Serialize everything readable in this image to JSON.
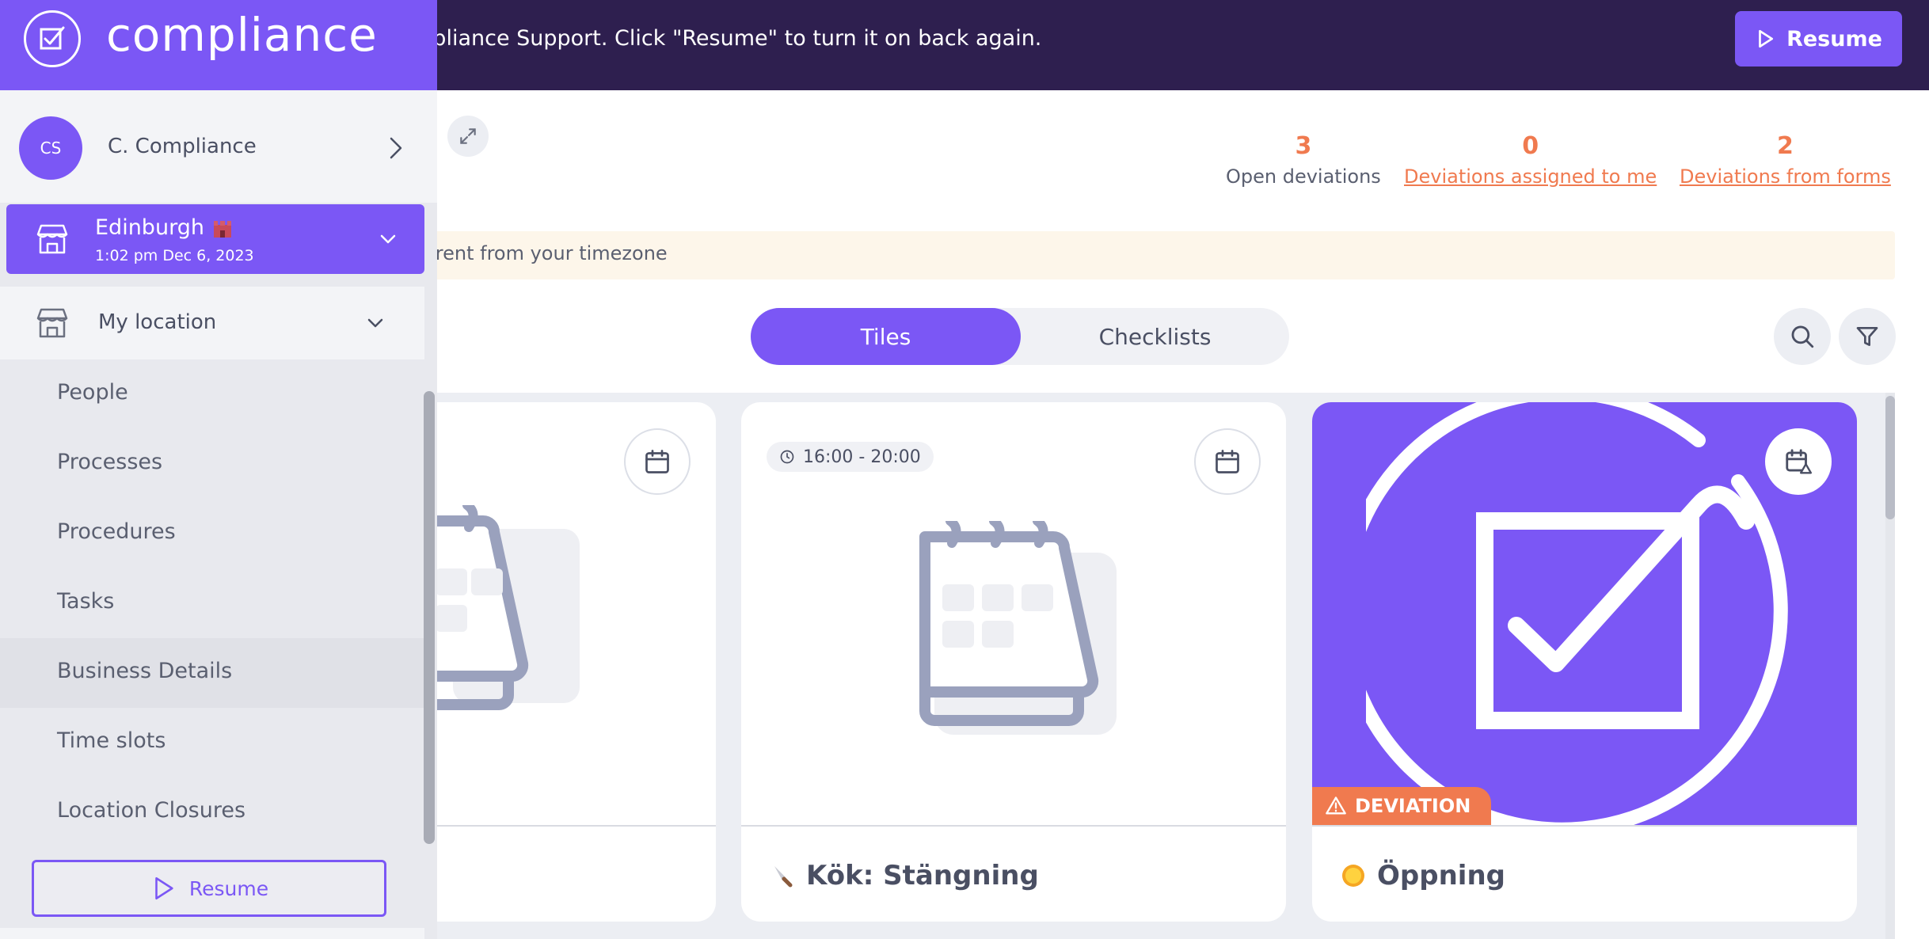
{
  "banner": {
    "message": "mpliance Support. Click \"Resume\" to turn it on back again.",
    "resume_label": "Resume"
  },
  "stats": {
    "open_deviations": {
      "value": "3",
      "label": "Open deviations"
    },
    "assigned_to_me": {
      "value": "0",
      "label": "Deviations assigned to me"
    },
    "from_forms": {
      "value": "2",
      "label": "Deviations from forms"
    }
  },
  "timezone_notice": "erent from your timezone",
  "view_toggle": {
    "tiles": "Tiles",
    "checklists": "Checklists",
    "selected": "Tiles"
  },
  "tiles": [
    {
      "title": "",
      "icon": "calendar-icon"
    },
    {
      "time": "16:00 - 20:00",
      "title": "Kök: Stängning",
      "emoji": "knife-icon"
    },
    {
      "badge": "DEVIATION",
      "title": "Öppning",
      "emoji": "sun-icon"
    }
  ],
  "sidebar": {
    "brand": "compliance",
    "user": {
      "initials": "CS",
      "name": "C. Compliance"
    },
    "location": {
      "name": "Edinburgh",
      "flag": "castle-icon",
      "time": "1:02 pm Dec 6, 2023"
    },
    "my_location_label": "My location",
    "items": [
      {
        "label": "People"
      },
      {
        "label": "Processes"
      },
      {
        "label": "Procedures"
      },
      {
        "label": "Tasks"
      },
      {
        "label": "Business Details"
      },
      {
        "label": "Time slots"
      },
      {
        "label": "Location Closures"
      }
    ],
    "resume_label": "Resume"
  },
  "colors": {
    "accent": "#7b57f5",
    "banner": "#2e1f4f",
    "warning": "#f07a4f"
  }
}
